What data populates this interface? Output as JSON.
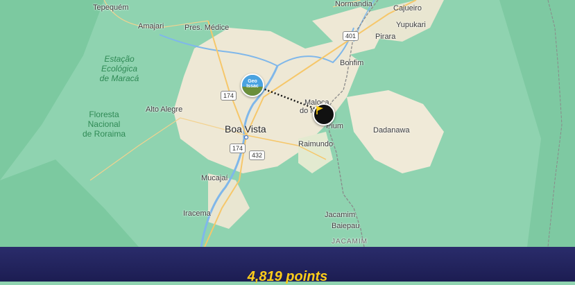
{
  "map": {
    "places": {
      "tepequem": "Tepequém",
      "normandia": "Normandia",
      "cajueiro": "Cajueiro",
      "amajari": "Amajari",
      "pres_medice": "Pres. Médice",
      "yupukari": "Yupukari",
      "pirara": "Pirara",
      "bonfim": "Bonfim",
      "maloca_line1": "Maloca",
      "maloca_line2": "do Malha",
      "alto_alegre": "Alto Alegre",
      "pium": "Pium",
      "dadanawa": "Dadanawa",
      "boa_vista": "Boa Vista",
      "raimundo": "Raimundo",
      "mucajai": "Mucajaí",
      "iracema": "Iracema",
      "jacamim": "Jacamim",
      "baiepau": "Baiepau",
      "jacamim_caps": "JACAMIM"
    },
    "parks": {
      "maraca_l1": "Estação",
      "maraca_l2": "Ecológica",
      "maraca_l3": "de Maracá",
      "roraima_l1": "Floresta",
      "roraima_l2": "Nacional",
      "roraima_l3": "de Roraima"
    },
    "roads": {
      "r401": "401",
      "r174a": "174",
      "r174b": "174",
      "r432": "432"
    },
    "guess_marker": {
      "label": "Geo Issac",
      "icon": "player-avatar-icon"
    },
    "answer_marker": {
      "icon": "flag-icon",
      "color": "#fecd19"
    }
  },
  "result": {
    "score_text": "4,819 points"
  },
  "colors": {
    "map_green": "#8fd3b0",
    "savanna": "#f0ead8",
    "footer": "#1c1d52",
    "score": "#fecd19"
  }
}
